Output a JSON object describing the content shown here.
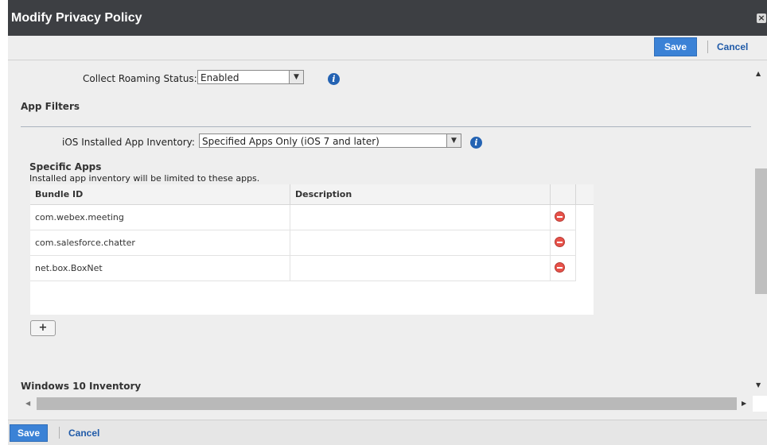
{
  "dialog": {
    "title": "Modify Privacy Policy",
    "close_icon": "close-icon"
  },
  "toolbar_top": {
    "save_label": "Save",
    "cancel_label": "Cancel"
  },
  "roaming": {
    "label": "Collect Roaming Status:",
    "value": "Enabled"
  },
  "app_filters": {
    "title": "App Filters",
    "ios_label": "iOS Installed App Inventory:",
    "ios_value": "Specified Apps Only (iOS 7 and later)"
  },
  "specific_apps": {
    "title": "Specific Apps",
    "subtitle": "Installed app inventory will be limited to these apps.",
    "columns": [
      "Bundle ID",
      "Description"
    ],
    "rows": [
      {
        "bundle_id": "com.webex.meeting",
        "description": ""
      },
      {
        "bundle_id": "com.salesforce.chatter",
        "description": ""
      },
      {
        "bundle_id": "net.box.BoxNet",
        "description": ""
      }
    ],
    "add_label": "+"
  },
  "windows_section": {
    "title": "Windows 10 Inventory"
  },
  "footer": {
    "save_label": "Save",
    "cancel_label": "Cancel"
  },
  "colors": {
    "title_bar": "#3d3f43",
    "accent": "#3b82d6",
    "link": "#1f5aa8",
    "info": "#2463b3",
    "remove": "#e8524a"
  }
}
